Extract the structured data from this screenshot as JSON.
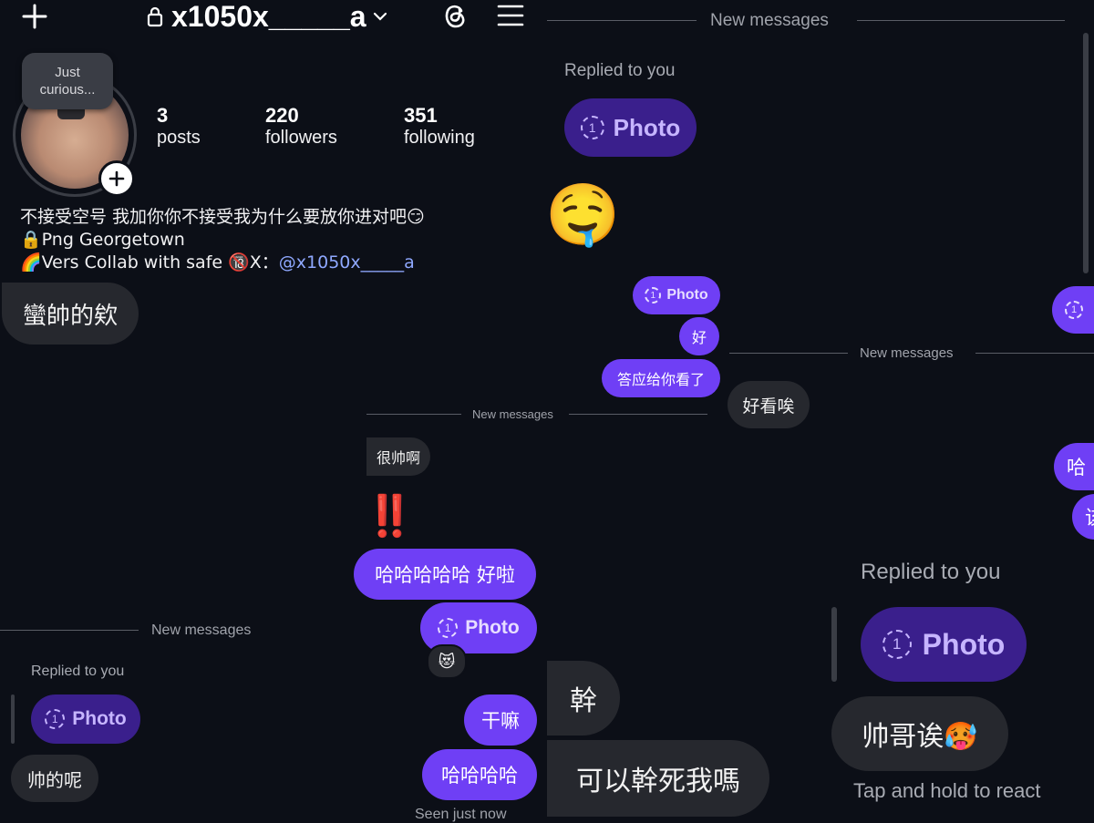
{
  "profile": {
    "username": "x1050x_____a",
    "note": "Just curious...",
    "stats": [
      {
        "value": "3",
        "label": "posts"
      },
      {
        "value": "220",
        "label": "followers"
      },
      {
        "value": "351",
        "label": "following"
      }
    ],
    "bio_line1": "不接受空号 我加你你不接受我为什么要放你进对吧😏",
    "bio_line2": "🔒Png  Georgetown",
    "bio_line3_prefix": "🌈Vers Collab with safe 🔞X：",
    "bio_link": "@x1050x_____a"
  },
  "icons": {
    "plus": "plus-icon",
    "lock": "lock-icon",
    "chevron": "chevron-down-icon",
    "threads": "threads-icon",
    "menu": "hamburger-menu-icon",
    "photo_count": "1"
  },
  "colors": {
    "background": "#0c0f17",
    "bubble_sent": "#6f3ff5",
    "bubble_received": "#26282e",
    "reply_photo": "#3a1f8c",
    "link": "#8fa8ff"
  },
  "labels": {
    "new_messages": "New messages",
    "replied_to_you": "Replied to you",
    "photo": "Photo",
    "tap_hold": "Tap and hold to react",
    "seen": "Seen just now"
  },
  "messages": {
    "col1_received": "蠻帥的欸",
    "col1_reply_received": "帅的呢",
    "col2_received": "很帅啊",
    "col2_emoji": "‼️",
    "col2_sent1": "哈哈哈哈哈 好啦",
    "col2_reaction": "😻",
    "col2_sent2": "干嘛",
    "col2_sent3": "哈哈哈哈",
    "col3_emoji": "🤤",
    "col3_sent1": "好",
    "col3_sent2": "答应给你看了",
    "col3_received1": "好看唉",
    "col3_received2": "幹",
    "col3_received3": "可以幹死我嗎",
    "col4_received": "帅哥诶🥵",
    "edge_sent1": "哈",
    "edge_sent2": "该"
  }
}
